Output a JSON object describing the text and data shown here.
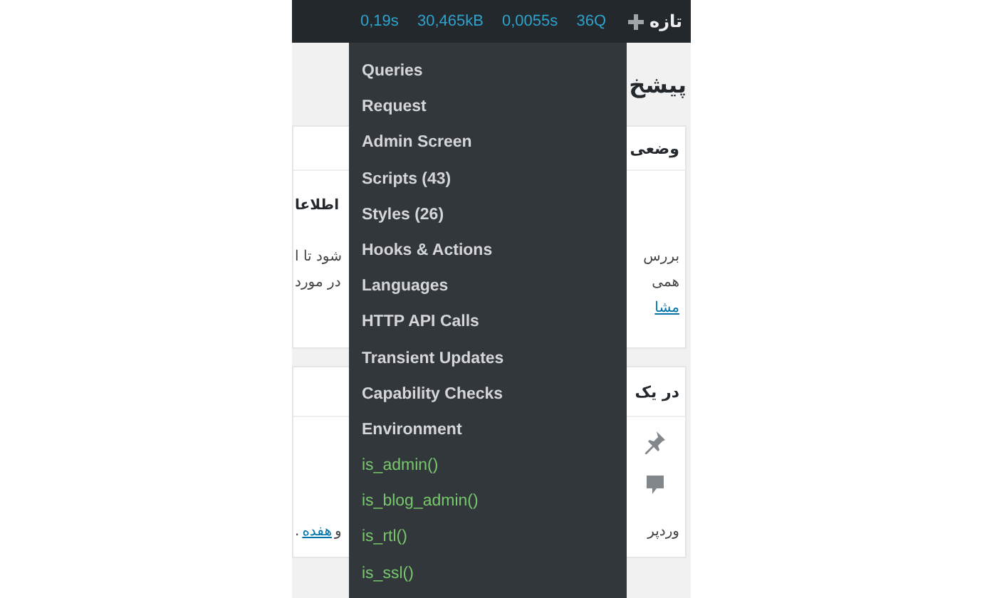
{
  "admin_bar": {
    "new_label": "تازه",
    "stats": "0,19s 30,465kB 0,0055s 36Q"
  },
  "menu": {
    "items": [
      {
        "label": "Queries",
        "kind": "panel"
      },
      {
        "label": "Request",
        "kind": "panel"
      },
      {
        "label": "Admin Screen",
        "kind": "panel"
      },
      {
        "label": "Scripts (43)",
        "kind": "panel"
      },
      {
        "label": "Styles (26)",
        "kind": "panel"
      },
      {
        "label": "Hooks & Actions",
        "kind": "panel"
      },
      {
        "label": "Languages",
        "kind": "panel"
      },
      {
        "label": "HTTP API Calls",
        "kind": "panel"
      },
      {
        "label": "Transient Updates",
        "kind": "panel"
      },
      {
        "label": "Capability Checks",
        "kind": "panel"
      },
      {
        "label": "Environment",
        "kind": "panel"
      },
      {
        "label": "is_admin()",
        "kind": "condition"
      },
      {
        "label": "is_blog_admin()",
        "kind": "condition"
      },
      {
        "label": "is_rtl()",
        "kind": "condition"
      },
      {
        "label": "is_ssl()",
        "kind": "condition"
      }
    ]
  },
  "page_title": "پیشخ",
  "boxes": [
    {
      "kind": "glance",
      "title": "وضعی",
      "lines": [
        {
          "kind": "heading",
          "left": [
            {
              "text": "اطلاعا",
              "link": false
            }
          ]
        },
        {
          "kind": "text",
          "left": [
            {
              "text": "شود تا ا",
              "link": false
            }
          ],
          "right": [
            {
              "text": "بررس",
              "link": false
            }
          ]
        },
        {
          "kind": "text",
          "left": [
            {
              "text": "در مورد",
              "link": false
            }
          ],
          "right": [
            {
              "text": "همی",
              "link": false
            }
          ]
        },
        {
          "kind": "text",
          "right": [
            {
              "text": "مشا",
              "link": true
            }
          ]
        }
      ]
    },
    {
      "kind": "activity",
      "title": "در یک",
      "lines": [
        {
          "kind": "text",
          "left": [
            {
              "text": "و",
              "link": false
            },
            {
              "text": "هفده",
              "link": true
            },
            {
              "text": ".",
              "link": false
            }
          ],
          "right": [
            {
              "text": "وردپر",
              "link": false
            }
          ]
        }
      ]
    }
  ]
}
